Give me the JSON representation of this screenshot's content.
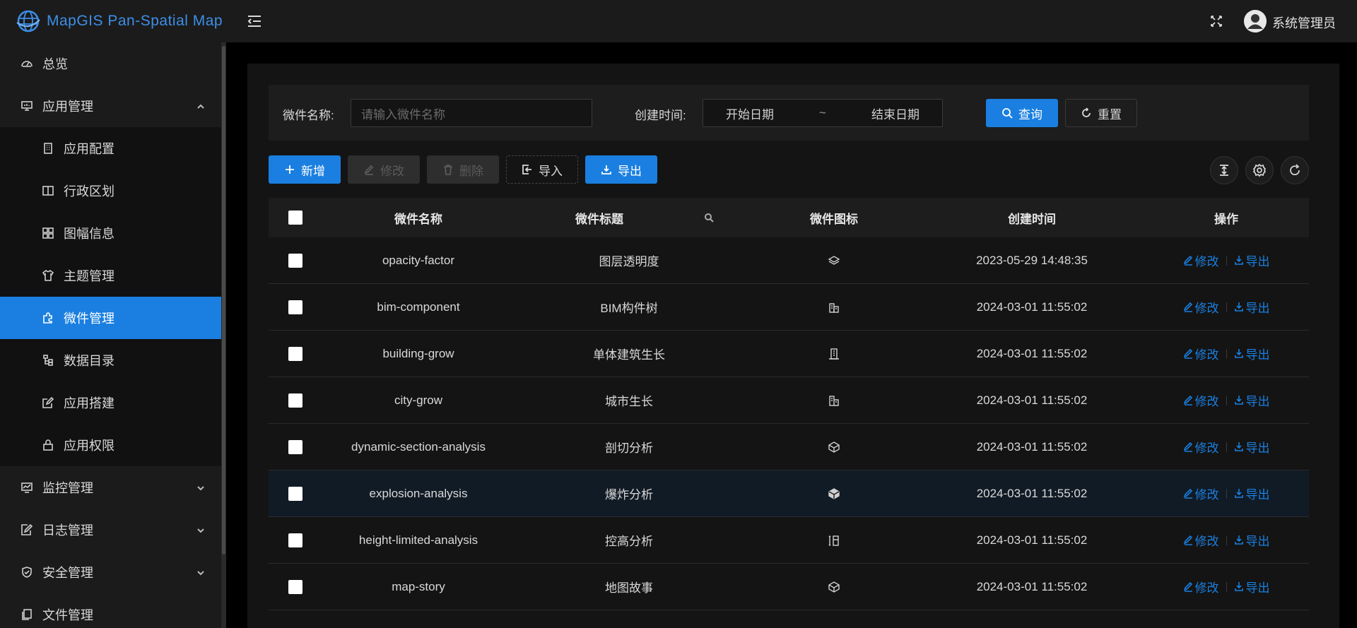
{
  "app": {
    "logo_text": "MapGIS Pan-Spatial Map"
  },
  "header": {
    "username": "系统管理员"
  },
  "sidebar": {
    "items": [
      {
        "label": "总览",
        "icon": "dashboard-icon"
      },
      {
        "label": "应用管理",
        "icon": "monitor-icon",
        "expanded": true
      },
      {
        "label": "监控管理",
        "icon": "chart-icon"
      },
      {
        "label": "日志管理",
        "icon": "log-icon"
      },
      {
        "label": "安全管理",
        "icon": "shield-icon"
      },
      {
        "label": "文件管理",
        "icon": "file-icon"
      }
    ],
    "sub_items": [
      {
        "label": "应用配置",
        "icon": "building-icon"
      },
      {
        "label": "行政区划",
        "icon": "columns-icon"
      },
      {
        "label": "图幅信息",
        "icon": "grid-icon"
      },
      {
        "label": "主题管理",
        "icon": "shirt-icon"
      },
      {
        "label": "微件管理",
        "icon": "puzzle-icon",
        "active": true
      },
      {
        "label": "数据目录",
        "icon": "tree-icon"
      },
      {
        "label": "应用搭建",
        "icon": "edit-icon"
      },
      {
        "label": "应用权限",
        "icon": "lock-icon"
      }
    ]
  },
  "search": {
    "name_label": "微件名称:",
    "name_placeholder": "请输入微件名称",
    "time_label": "创建时间:",
    "start_placeholder": "开始日期",
    "range_sep": "~",
    "end_placeholder": "结束日期",
    "query_label": "查询",
    "reset_label": "重置"
  },
  "toolbar": {
    "add_label": "新增",
    "edit_label": "修改",
    "delete_label": "删除",
    "import_label": "导入",
    "export_label": "导出"
  },
  "table": {
    "headers": {
      "name": "微件名称",
      "title": "微件标题",
      "icon": "微件图标",
      "time": "创建时间",
      "ops": "操作"
    },
    "op_edit": "修改",
    "op_export": "导出",
    "rows": [
      {
        "name": "opacity-factor",
        "title": "图层透明度",
        "time": "2023-05-29 14:48:35",
        "icon": "layers-icon"
      },
      {
        "name": "bim-component",
        "title": "BIM构件树",
        "time": "2024-03-01 11:55:02",
        "icon": "buildings-icon"
      },
      {
        "name": "building-grow",
        "title": "单体建筑生长",
        "time": "2024-03-01 11:55:02",
        "icon": "tower-icon"
      },
      {
        "name": "city-grow",
        "title": "城市生长",
        "time": "2024-03-01 11:55:02",
        "icon": "city-icon"
      },
      {
        "name": "dynamic-section-analysis",
        "title": "剖切分析",
        "time": "2024-03-01 11:55:02",
        "icon": "cube-cut-icon"
      },
      {
        "name": "explosion-analysis",
        "title": "爆炸分析",
        "time": "2024-03-01 11:55:02",
        "icon": "cube-icon"
      },
      {
        "name": "height-limited-analysis",
        "title": "控高分析",
        "time": "2024-03-01 11:55:02",
        "icon": "height-icon"
      },
      {
        "name": "map-story",
        "title": "地图故事",
        "time": "2024-03-01 11:55:02",
        "icon": "cube-cut-icon"
      }
    ]
  },
  "colors": {
    "accent": "#1a7fe0",
    "sidebar_bg": "#1b1b1b",
    "page_bg": "#000000"
  }
}
